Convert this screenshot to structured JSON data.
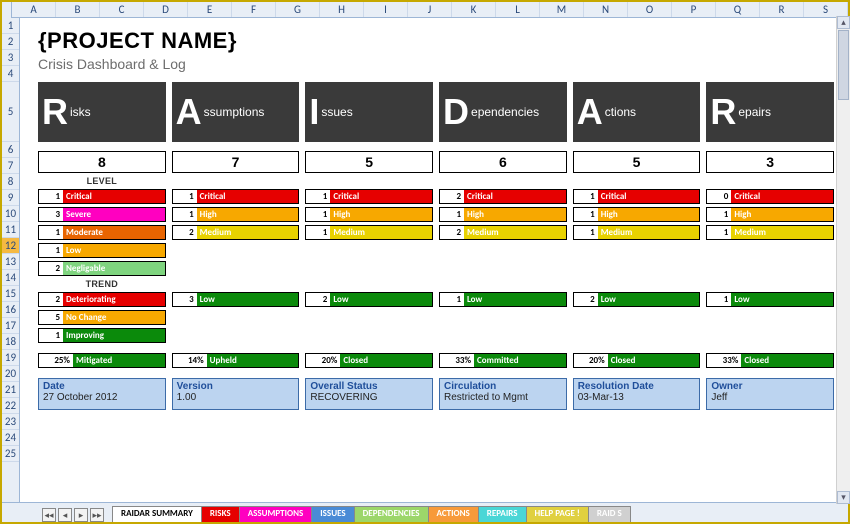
{
  "columns": [
    "A",
    "B",
    "C",
    "D",
    "E",
    "F",
    "G",
    "H",
    "I",
    "J",
    "K",
    "L",
    "M",
    "N",
    "O",
    "P",
    "Q",
    "R",
    "S"
  ],
  "rows": [
    "1",
    "2",
    "3",
    "4",
    "5",
    "6",
    "7",
    "8",
    "9",
    "10",
    "11",
    "12",
    "13",
    "14",
    "15",
    "16",
    "17",
    "18",
    "19",
    "20",
    "21",
    "22",
    "23",
    "24",
    "25"
  ],
  "title": "{PROJECT NAME}",
  "subtitle": "Crisis Dashboard & Log",
  "level_header": "LEVEL",
  "trend_header": "TREND",
  "raidar_cols": [
    {
      "big": "R",
      "rest": "isks",
      "count": "8",
      "levels": [
        {
          "n": "1",
          "label": "Critical",
          "cls": "bg-critical"
        },
        {
          "n": "3",
          "label": "Severe",
          "cls": "bg-severe"
        },
        {
          "n": "1",
          "label": "Moderate",
          "cls": "bg-moderate"
        },
        {
          "n": "1",
          "label": "Low",
          "cls": "bg-low"
        },
        {
          "n": "2",
          "label": "Negligable",
          "cls": "bg-negl"
        }
      ],
      "trend": [
        {
          "n": "2",
          "label": "Deteriorating",
          "cls": "bg-deterior"
        },
        {
          "n": "5",
          "label": "No Change",
          "cls": "bg-nochange"
        },
        {
          "n": "1",
          "label": "Improving",
          "cls": "bg-improv"
        }
      ],
      "status": {
        "pct": "25%",
        "label": "Mitigated"
      }
    },
    {
      "big": "A",
      "rest": "ssumptions",
      "count": "7",
      "levels": [
        {
          "n": "1",
          "label": "Critical",
          "cls": "bg-critical"
        },
        {
          "n": "1",
          "label": "High",
          "cls": "bg-high"
        },
        {
          "n": "2",
          "label": "Medium",
          "cls": "bg-medium"
        }
      ],
      "trend": [
        {
          "n": "3",
          "label": "Low",
          "cls": "bg-lowg"
        }
      ],
      "status": {
        "pct": "14%",
        "label": "Upheld"
      }
    },
    {
      "big": "I",
      "rest": "ssues",
      "count": "5",
      "levels": [
        {
          "n": "1",
          "label": "Critical",
          "cls": "bg-critical"
        },
        {
          "n": "1",
          "label": "High",
          "cls": "bg-high"
        },
        {
          "n": "1",
          "label": "Medium",
          "cls": "bg-medium"
        }
      ],
      "trend": [
        {
          "n": "2",
          "label": "Low",
          "cls": "bg-lowg"
        }
      ],
      "status": {
        "pct": "20%",
        "label": "Closed"
      }
    },
    {
      "big": "D",
      "rest": "ependencies",
      "count": "6",
      "levels": [
        {
          "n": "2",
          "label": "Critical",
          "cls": "bg-critical"
        },
        {
          "n": "1",
          "label": "High",
          "cls": "bg-high"
        },
        {
          "n": "2",
          "label": "Medium",
          "cls": "bg-medium"
        }
      ],
      "trend": [
        {
          "n": "1",
          "label": "Low",
          "cls": "bg-lowg"
        }
      ],
      "status": {
        "pct": "33%",
        "label": "Committed"
      }
    },
    {
      "big": "A",
      "rest": "ctions",
      "count": "5",
      "levels": [
        {
          "n": "1",
          "label": "Critical",
          "cls": "bg-critical"
        },
        {
          "n": "1",
          "label": "High",
          "cls": "bg-high"
        },
        {
          "n": "1",
          "label": "Medium",
          "cls": "bg-medium"
        }
      ],
      "trend": [
        {
          "n": "2",
          "label": "Low",
          "cls": "bg-lowg"
        }
      ],
      "status": {
        "pct": "20%",
        "label": "Closed"
      }
    },
    {
      "big": "R",
      "rest": "epairs",
      "count": "3",
      "levels": [
        {
          "n": "0",
          "label": "Critical",
          "cls": "bg-critical"
        },
        {
          "n": "1",
          "label": "High",
          "cls": "bg-high"
        },
        {
          "n": "1",
          "label": "Medium",
          "cls": "bg-medium"
        }
      ],
      "trend": [
        {
          "n": "1",
          "label": "Low",
          "cls": "bg-lowg"
        }
      ],
      "status": {
        "pct": "33%",
        "label": "Closed"
      }
    }
  ],
  "footer": [
    {
      "label": "Date",
      "value": "27 October 2012"
    },
    {
      "label": "Version",
      "value": "1.00"
    },
    {
      "label": "Overall Status",
      "value": "RECOVERING"
    },
    {
      "label": "Circulation",
      "value": "Restricted to Mgmt"
    },
    {
      "label": "Resolution Date",
      "value": "03-Mar-13"
    },
    {
      "label": "Owner",
      "value": "Jeff"
    }
  ],
  "tabs": [
    {
      "label": "RAIDAR SUMMARY",
      "bg": "#ffffff"
    },
    {
      "label": "RISKS",
      "bg": "#e60000"
    },
    {
      "label": "ASSUMPTIONS",
      "bg": "#ff00c0"
    },
    {
      "label": "ISSUES",
      "bg": "#4a8bd6"
    },
    {
      "label": "DEPENDENCIES",
      "bg": "#9cd66a"
    },
    {
      "label": "ACTIONS",
      "bg": "#f79a3a"
    },
    {
      "label": "REPAIRS",
      "bg": "#4ad6d6"
    },
    {
      "label": "HELP PAGE !",
      "bg": "#e0d040"
    },
    {
      "label": "RAID S",
      "bg": "#d0d0d0"
    }
  ],
  "nav_glyphs": [
    "◂◂",
    "◂",
    "▸",
    "▸▸"
  ]
}
